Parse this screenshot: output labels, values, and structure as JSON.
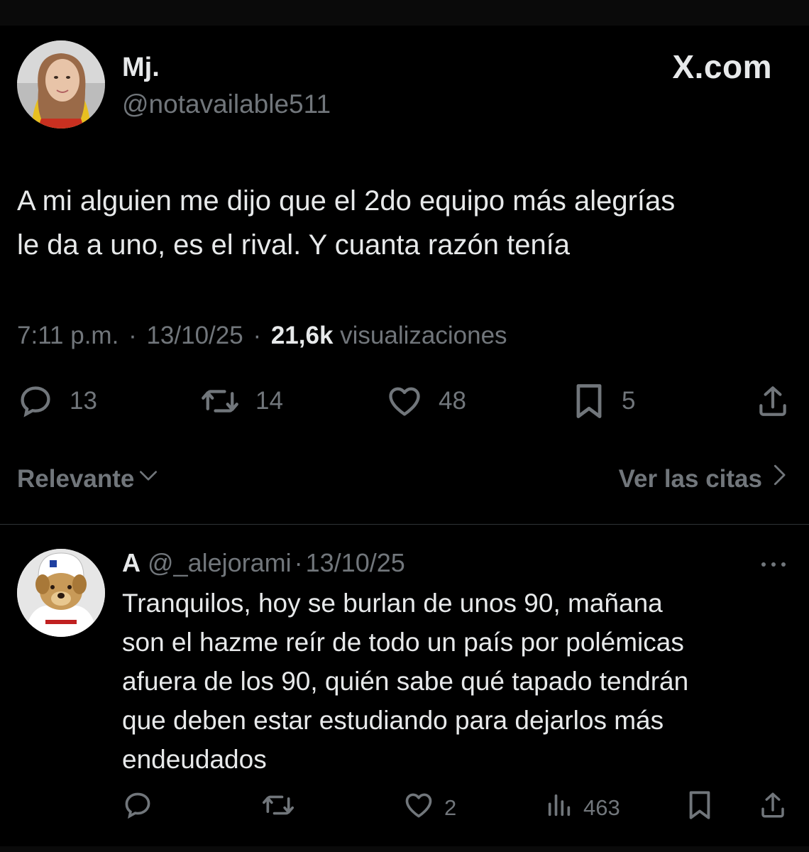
{
  "site_label": "X.com",
  "tweet": {
    "author": "Mj.",
    "handle": "@notavailable511",
    "text_lines": [
      "A mi alguien me dijo que el 2do equipo más alegrías",
      "le da a uno, es el rival. Y cuanta razón tenía"
    ],
    "time": "7:11 p.m.",
    "date": "13/10/25",
    "views_count": "21,6k",
    "views_label": "visualizaciones",
    "separator": "·",
    "stats": {
      "replies": "13",
      "reposts": "14",
      "likes": "48",
      "bookmarks": "5"
    }
  },
  "sort": {
    "label": "Relevante",
    "quotes_label": "Ver las citas"
  },
  "reply": {
    "author": "A",
    "handle": "@_alejorami",
    "date": "13/10/25",
    "text_lines": [
      "Tranquilos, hoy se burlan de unos 90, mañana",
      "son el hazme reír de todo un país por polémicas",
      "afuera de los 90, quién sabe qué tapado tendrán",
      "que deben estar estudiando para dejarlos más",
      "endeudados"
    ],
    "stats": {
      "likes": "2",
      "views": "463"
    }
  },
  "icons": {
    "reply": "reply-icon",
    "repost": "repost-icon",
    "like": "heart-icon",
    "bookmark": "bookmark-icon",
    "share": "share-icon",
    "views": "analytics-icon",
    "more": "more-icon"
  },
  "colors": {
    "background": "#000000",
    "text": "#e7e9ea",
    "muted": "#71767b",
    "divider": "#2f3336"
  }
}
